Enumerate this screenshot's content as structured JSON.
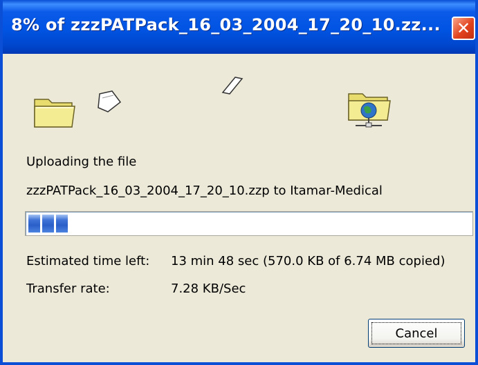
{
  "window": {
    "title": "8% of zzzPATPack_16_03_2004_17_20_10.zz...",
    "close_glyph": "✕"
  },
  "icons": {
    "source_folder": "folder-icon",
    "destination": "network-folder-icon",
    "paper": "document-page-icon"
  },
  "status": {
    "action": "Uploading the file",
    "detail": "zzzPATPack_16_03_2004_17_20_10.zzp to Itamar-Medical"
  },
  "progress": {
    "percent": 8,
    "color": "#2a5fc9"
  },
  "info": {
    "time_left_label": "Estimated time left:",
    "time_left_value": "13 min 48 sec (570.0 KB of 6.74 MB copied)",
    "rate_label": "Transfer rate:",
    "rate_value": "7.28 KB/Sec"
  },
  "buttons": {
    "cancel": "Cancel"
  },
  "colors": {
    "titlebar": "#0054e3",
    "close": "#e2431e",
    "dialog_bg": "#ece9d8"
  }
}
